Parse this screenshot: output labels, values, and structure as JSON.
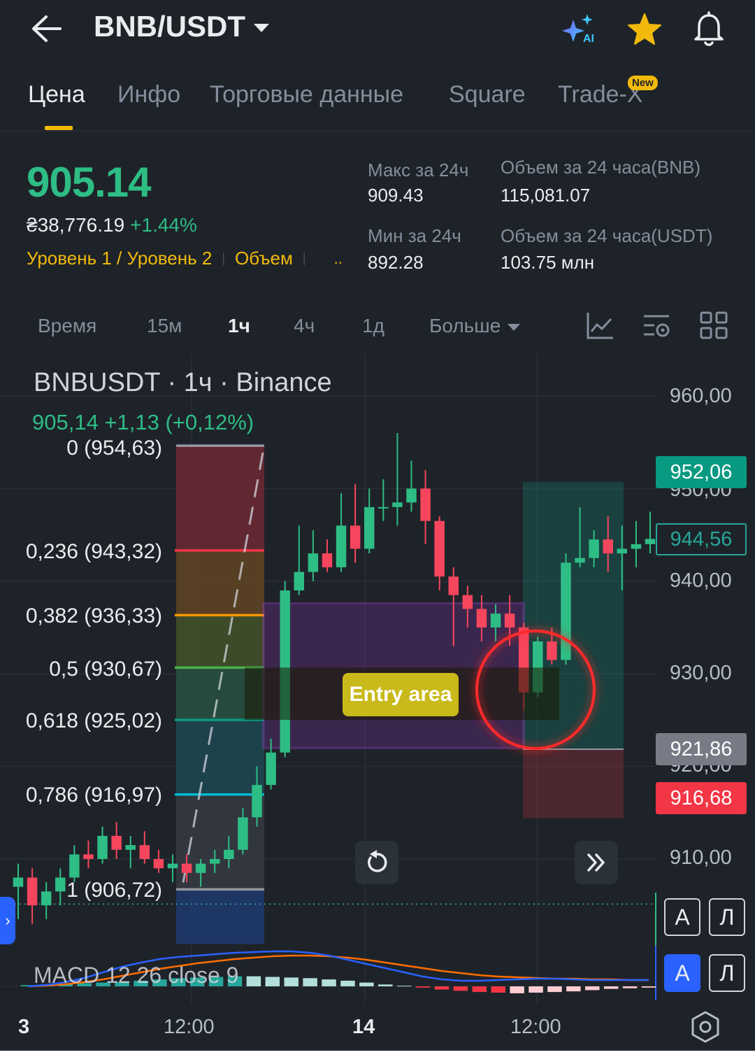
{
  "header": {
    "pair": "BNB/USDT",
    "icons": [
      "back-arrow-icon",
      "ai-sparkle-icon",
      "star-icon",
      "bell-icon"
    ],
    "ai_badge": "AI"
  },
  "tabs": [
    {
      "label": "Цена",
      "active": true
    },
    {
      "label": "Инфо"
    },
    {
      "label": "Торговые данные"
    },
    {
      "label": "Square"
    },
    {
      "label": "Trade-X",
      "badge": "New"
    }
  ],
  "price": {
    "last": "905.14",
    "fiat": "₴38,776.19",
    "change": "+1.44%",
    "links": [
      "Уровень 1 / Уровень 2",
      "Объем",
      ".."
    ],
    "stats": {
      "high_label": "Макс за 24ч",
      "high_value": "909.43",
      "low_label": "Мин за 24ч",
      "low_value": "892.28",
      "vol_base_label": "Объем за 24 часа(BNB)",
      "vol_base_value": "115,081.07",
      "vol_quote_label": "Объем за 24 часа(USDT)",
      "vol_quote_value": "103.75 млн"
    }
  },
  "intervals": {
    "items": [
      "Время",
      "15м",
      "1ч",
      "4ч",
      "1д",
      "Больше"
    ],
    "active": "1ч",
    "tools": [
      "indicator-chart-icon",
      "chart-settings-icon",
      "grid-layout-icon"
    ]
  },
  "chart": {
    "title": "BNBUSDT · 1ч · Binance",
    "ohlc_line": "905,14  +1,13 (+0,12%)",
    "fib_levels": [
      {
        "label": "0 (954,63)",
        "value": 954.63,
        "color": "#9598a1"
      },
      {
        "label": "0,236 (943,32)",
        "value": 943.32,
        "color": "#f23645"
      },
      {
        "label": "0,382 (936,33)",
        "value": 936.33,
        "color": "#ff9800"
      },
      {
        "label": "0,5 (930,67)",
        "value": 930.67,
        "color": "#4caf50"
      },
      {
        "label": "0,618 (925,02)",
        "value": 925.02,
        "color": "#089981"
      },
      {
        "label": "0,786 (916,97)",
        "value": 916.97,
        "color": "#00bcd4"
      },
      {
        "label": "1 (906,72)",
        "value": 906.72,
        "color": "#9598a1"
      }
    ],
    "y_ticks": [
      "960,00",
      "950,00",
      "940,00",
      "930,00",
      "920,00",
      "910,00"
    ],
    "price_tags": [
      {
        "label": "952,06",
        "kind": "target",
        "color": "#089981"
      },
      {
        "label": "944,56",
        "kind": "current",
        "color": "#26a69a"
      },
      {
        "label": "921,86",
        "kind": "entry",
        "color": "#787b86"
      },
      {
        "label": "916,68",
        "kind": "stop",
        "color": "#f23645"
      }
    ],
    "entry_label": "Entry area",
    "x_ticks": [
      "3",
      "12:00",
      "14",
      "12:00"
    ],
    "macd_label": "MACD 12 26 close 9",
    "scale_buttons": [
      {
        "label": "А"
      },
      {
        "label": "Л"
      },
      {
        "label": "А",
        "on": true
      },
      {
        "label": "Л"
      }
    ],
    "colors": {
      "up": "#2ebd85",
      "down": "#f6465d"
    }
  },
  "chart_data": {
    "type": "candlestick",
    "title": "BNBUSDT · 1ч · Binance",
    "ylim": [
      902,
      963
    ],
    "candles": [
      [
        907.0,
        909.5,
        903.5,
        908.0
      ],
      [
        908.0,
        909.0,
        903.0,
        905.0
      ],
      [
        905.0,
        907.5,
        903.5,
        906.5
      ],
      [
        906.5,
        909.0,
        905.0,
        908.0
      ],
      [
        908.0,
        911.5,
        907.5,
        910.5
      ],
      [
        910.5,
        912.0,
        909.0,
        910.0
      ],
      [
        910.0,
        913.5,
        909.5,
        912.5
      ],
      [
        912.5,
        914.0,
        910.0,
        911.0
      ],
      [
        911.0,
        912.5,
        909.0,
        911.5
      ],
      [
        911.5,
        913.0,
        909.5,
        910.0
      ],
      [
        910.0,
        911.0,
        908.5,
        909.0
      ],
      [
        909.0,
        910.5,
        907.5,
        909.5
      ],
      [
        909.5,
        910.5,
        907.5,
        908.5
      ],
      [
        908.5,
        910.0,
        907.0,
        909.5
      ],
      [
        909.5,
        911.0,
        908.5,
        910.0
      ],
      [
        910.0,
        912.5,
        909.0,
        911.0
      ],
      [
        911.0,
        915.5,
        910.5,
        914.5
      ],
      [
        914.5,
        920.0,
        913.5,
        918.0
      ],
      [
        918.0,
        923.0,
        917.5,
        921.5
      ],
      [
        921.5,
        940.0,
        921.0,
        939.0
      ],
      [
        939.0,
        946.0,
        938.5,
        941.0
      ],
      [
        941.0,
        945.5,
        940.0,
        943.0
      ],
      [
        943.0,
        944.5,
        941.0,
        941.5
      ],
      [
        941.5,
        949.5,
        941.0,
        946.0
      ],
      [
        946.0,
        950.5,
        942.0,
        943.5
      ],
      [
        943.5,
        950.0,
        943.0,
        948.0
      ],
      [
        948.0,
        951.0,
        946.5,
        948.0
      ],
      [
        948.0,
        956.0,
        946.0,
        948.5
      ],
      [
        948.5,
        953.0,
        947.5,
        950.0
      ],
      [
        950.0,
        952.0,
        944.0,
        946.5
      ],
      [
        946.5,
        947.0,
        939.0,
        940.5
      ],
      [
        940.5,
        941.5,
        933.0,
        938.5
      ],
      [
        938.5,
        939.5,
        935.0,
        937.0
      ],
      [
        937.0,
        938.5,
        933.5,
        935.0
      ],
      [
        935.0,
        937.5,
        933.5,
        936.5
      ],
      [
        936.5,
        938.5,
        933.0,
        935.0
      ],
      [
        935.0,
        935.5,
        926.0,
        928.0
      ],
      [
        928.0,
        934.0,
        927.5,
        933.5
      ],
      [
        933.5,
        935.0,
        931.0,
        931.5
      ],
      [
        931.5,
        943.0,
        931.0,
        942.0
      ],
      [
        942.0,
        948.0,
        941.5,
        942.5
      ],
      [
        942.5,
        945.5,
        941.5,
        944.5
      ],
      [
        944.5,
        947.0,
        941.0,
        943.0
      ],
      [
        943.0,
        946.0,
        939.0,
        943.5
      ],
      [
        943.5,
        946.5,
        941.5,
        944.0
      ],
      [
        944.0,
        947.5,
        943.0,
        944.56
      ]
    ],
    "macd_hist": [
      0.2,
      0.3,
      0.4,
      0.5,
      0.6,
      0.7,
      0.9,
      1.1,
      1.3,
      1.4,
      1.5,
      1.6,
      1.6,
      1.5,
      1.4,
      1.3,
      1.1,
      0.9,
      0.6,
      0.3,
      0.1,
      -0.2,
      -0.5,
      -0.7,
      -0.9,
      -1.0,
      -1.1,
      -1.0,
      -0.9,
      -0.8,
      -0.6,
      -0.4,
      -0.3,
      -0.2
    ],
    "macd_line": [
      0.0,
      0.2,
      0.6,
      1.2,
      2.0,
      2.8,
      3.4,
      3.9,
      4.2,
      4.4,
      4.6,
      4.8,
      4.9,
      5.0,
      5.0,
      4.8,
      4.4,
      3.8,
      3.2,
      2.6,
      2.0,
      1.4,
      1.0,
      0.8,
      0.8,
      0.9,
      1.0,
      1.1,
      1.1,
      1.0,
      0.9,
      0.9,
      0.9,
      0.9
    ],
    "signal_line": [
      0.0,
      0.1,
      0.3,
      0.6,
      1.0,
      1.5,
      2.0,
      2.5,
      2.9,
      3.3,
      3.6,
      3.9,
      4.1,
      4.3,
      4.4,
      4.4,
      4.3,
      4.1,
      3.8,
      3.4,
      3.0,
      2.6,
      2.2,
      1.9,
      1.6,
      1.4,
      1.3,
      1.2,
      1.1,
      1.1,
      1.0,
      1.0,
      0.9,
      0.9
    ]
  }
}
